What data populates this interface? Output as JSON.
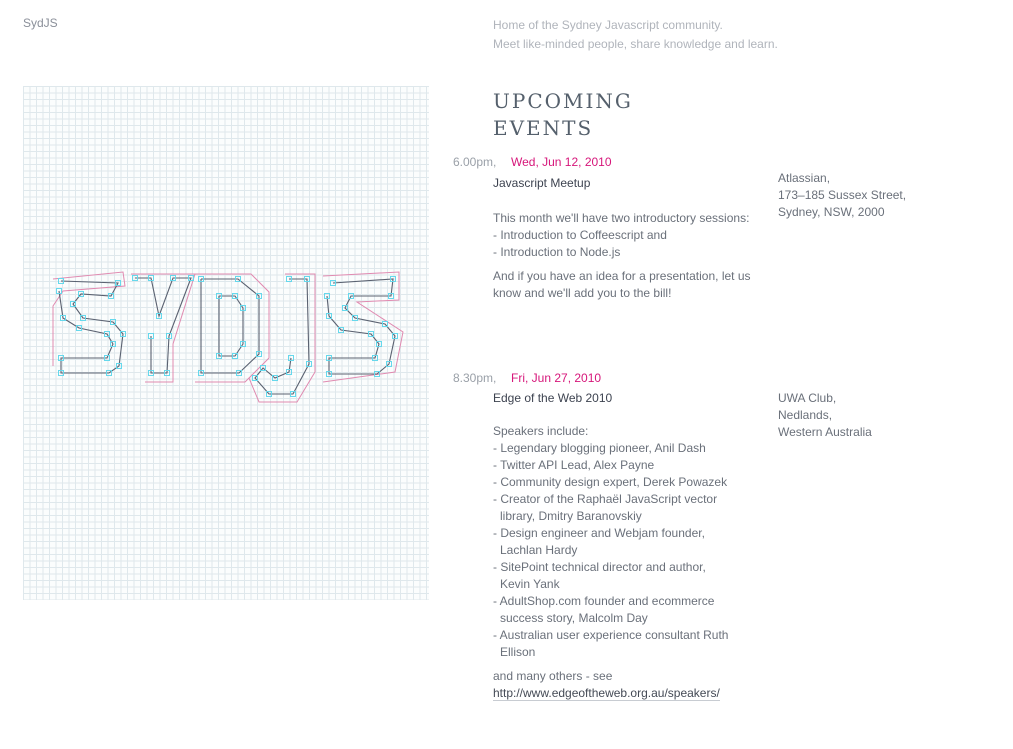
{
  "site": {
    "name": "SydJS"
  },
  "tagline": [
    "Home of the Sydney Javascript community.",
    "Meet like-minded people, share knowledge and learn."
  ],
  "logo": {
    "text": "SYDJS"
  },
  "heading": {
    "line1": "UPCOMING",
    "line2": "EVENTS"
  },
  "colors": {
    "accent": "#d6167a",
    "grid": "#dfe8ec",
    "logo_guide": "#e08ab0",
    "logo_node": "#66d8ec",
    "logo_stroke": "#5a6170"
  },
  "events": [
    {
      "time": "6.00pm,",
      "date": "Wed, Jun 12, 2010",
      "title": "Javascript Meetup",
      "intro": "This month we'll have two introductory sessions:",
      "items": [
        "- Introduction to Coffeescript and",
        "- Introduction to Node.js"
      ],
      "outro": "And if you have an idea for a presentation, let us know and we'll add you to the bill!",
      "venue": [
        "Atlassian,",
        "173–185 Sussex Street,",
        "Sydney, NSW, 2000"
      ]
    },
    {
      "time": "8.30pm,",
      "date": "Fri, Jun 27, 2010",
      "title": "Edge of the Web 2010",
      "intro": "Speakers include:",
      "items": [
        "- Legendary blogging pioneer, Anil Dash",
        "- Twitter API Lead, Alex Payne",
        "- Community design expert, Derek Powazek",
        "- Creator of the Raphaël JavaScript vector library, Dmitry Baranovskiy",
        "- Design engineer and Webjam founder, Lachlan Hardy",
        "- SitePoint technical director and author, Kevin Yank",
        "- AdultShop.com founder and ecommerce success story, Malcolm Day",
        "- Australian user experience consultant Ruth Ellison"
      ],
      "more": "and many others - see",
      "link": "http://www.edgeoftheweb.org.au/speakers/",
      "venue": [
        "UWA Club,",
        "Nedlands,",
        "Western Australia"
      ]
    }
  ]
}
